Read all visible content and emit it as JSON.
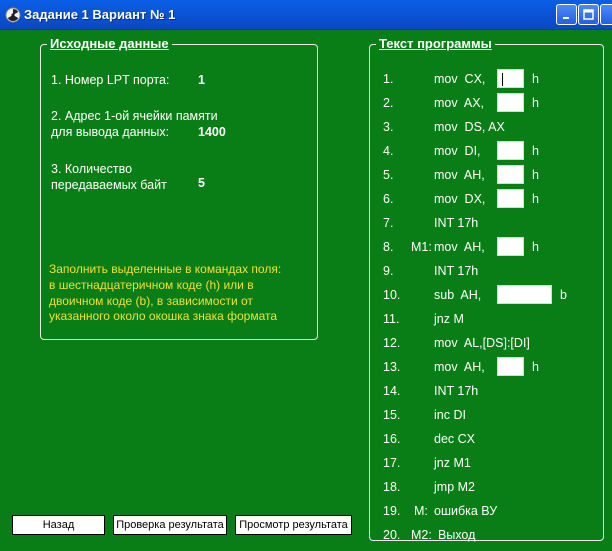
{
  "window": {
    "title": "Задание 1  Вариант № 1"
  },
  "left_panel": {
    "legend": "Исходные данные",
    "item1_label": "1. Номер LPT порта:",
    "item1_value": "1",
    "item2_label_line1": "2. Адрес 1-ой ячейки памяти",
    "item2_label_line2": "для вывода данных:",
    "item2_value": "1400",
    "item3_label_line1": "3. Количество",
    "item3_label_line2": "передаваемых байт",
    "item3_value": "5",
    "note_lines": [
      "Заполнить выделенные в командах поля:",
      "в шестнадцатеричном коде (h) или в",
      "двоичном коде (b), в зависимости от",
      "указанного около окошка знака формата"
    ]
  },
  "right_panel": {
    "legend": "Текст программы",
    "lines": [
      {
        "num": "1.",
        "label": "",
        "code": "mov  CX,",
        "suffix": "h"
      },
      {
        "num": "2.",
        "label": "",
        "code": "mov  AX,",
        "suffix": "h"
      },
      {
        "num": "3.",
        "label": "",
        "code": "mov  DS, AX",
        "suffix": ""
      },
      {
        "num": "4.",
        "label": "",
        "code": "mov  DI,",
        "suffix": "h"
      },
      {
        "num": "5.",
        "label": "",
        "code": "mov  AH,",
        "suffix": "h"
      },
      {
        "num": "6.",
        "label": "",
        "code": "mov  DX,",
        "suffix": "h"
      },
      {
        "num": "7.",
        "label": "",
        "code": "INT 17h",
        "suffix": ""
      },
      {
        "num": "8.",
        "label": "M1:",
        "code": "mov  AH,",
        "suffix": "h"
      },
      {
        "num": "9.",
        "label": "",
        "code": "INT 17h",
        "suffix": ""
      },
      {
        "num": "10.",
        "label": "",
        "code": "sub  AH,",
        "suffix": "b"
      },
      {
        "num": "11.",
        "label": "",
        "code": "jnz M",
        "suffix": ""
      },
      {
        "num": "12.",
        "label": "",
        "code": "mov  AL,[DS]:[DI]",
        "suffix": ""
      },
      {
        "num": "13.",
        "label": "",
        "code": "mov  AH,",
        "suffix": "h"
      },
      {
        "num": "14.",
        "label": "",
        "code": "INT 17h",
        "suffix": ""
      },
      {
        "num": "15.",
        "label": "",
        "code": "inc DI",
        "suffix": ""
      },
      {
        "num": "16.",
        "label": "",
        "code": "dec CX",
        "suffix": ""
      },
      {
        "num": "17.",
        "label": "",
        "code": "jnz M1",
        "suffix": ""
      },
      {
        "num": "18.",
        "label": "",
        "code": "jmp M2",
        "suffix": ""
      },
      {
        "num": "19.",
        "label": "M:",
        "code": "ошибка ВУ",
        "suffix": ""
      },
      {
        "num": "20.",
        "label": "M2:",
        "code": "Выход",
        "suffix": ""
      }
    ]
  },
  "buttons": {
    "back": "Назад",
    "check": "Проверка результата",
    "view": "Просмотр результата"
  }
}
